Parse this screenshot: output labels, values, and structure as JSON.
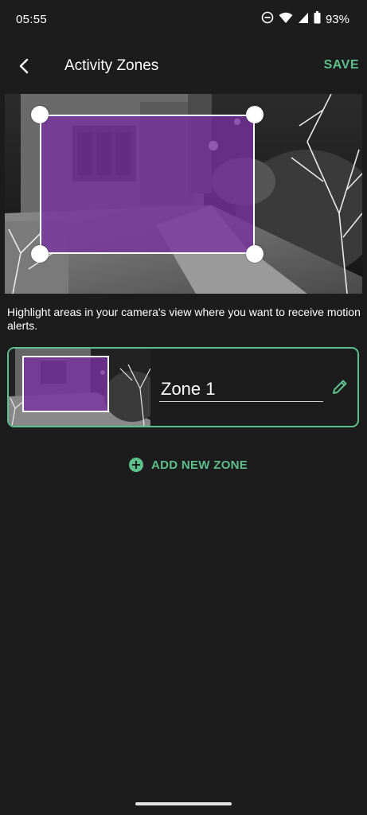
{
  "status_bar": {
    "time": "05:55",
    "battery": "93%",
    "icons": [
      "do-not-disturb-icon",
      "wifi-icon",
      "signal-icon",
      "battery-icon"
    ]
  },
  "app_bar": {
    "title": "Activity Zones",
    "save_label": "SAVE",
    "back_icon": "back-arrow-icon"
  },
  "hint": "Highlight areas in your camera's view where you want to receive motion alerts.",
  "zones": [
    {
      "name": "Zone 1",
      "edit_icon": "pencil-icon"
    }
  ],
  "add_zone": {
    "label": "ADD NEW ZONE",
    "icon": "plus-circle-icon"
  },
  "colors": {
    "accent": "#5fbf8c",
    "zone_fill": "#7832a0",
    "background": "#1c1c1c"
  }
}
